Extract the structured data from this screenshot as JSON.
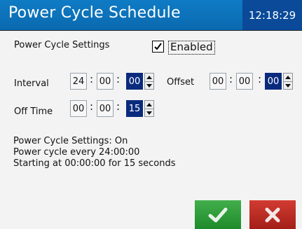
{
  "title": "Power Cycle Schedule",
  "clock": "12:18:29",
  "settings_label": "Power Cycle Settings",
  "enabled": {
    "label": "Enabled",
    "checked": true
  },
  "interval": {
    "label": "Interval",
    "hours": "24",
    "minutes": "00",
    "seconds": "00"
  },
  "offset": {
    "label": "Offset",
    "hours": "00",
    "minutes": "00",
    "seconds": "00"
  },
  "off_time": {
    "label": "Off Time",
    "hours": "00",
    "minutes": "00",
    "seconds": "15"
  },
  "status": [
    "Power Cycle Settings: On",
    "Power cycle every 24:00:00",
    "Starting at 00:00:00 for 15 seconds"
  ],
  "colors": {
    "title_bar": "#0a6aaf",
    "clock_bg": "#0a4a99",
    "selected_field": "#0a2b7d",
    "ok_button": "#2f9d3a",
    "cancel_button": "#c02f25"
  },
  "icons": {
    "ok": "checkmark-icon",
    "cancel": "x-icon"
  }
}
